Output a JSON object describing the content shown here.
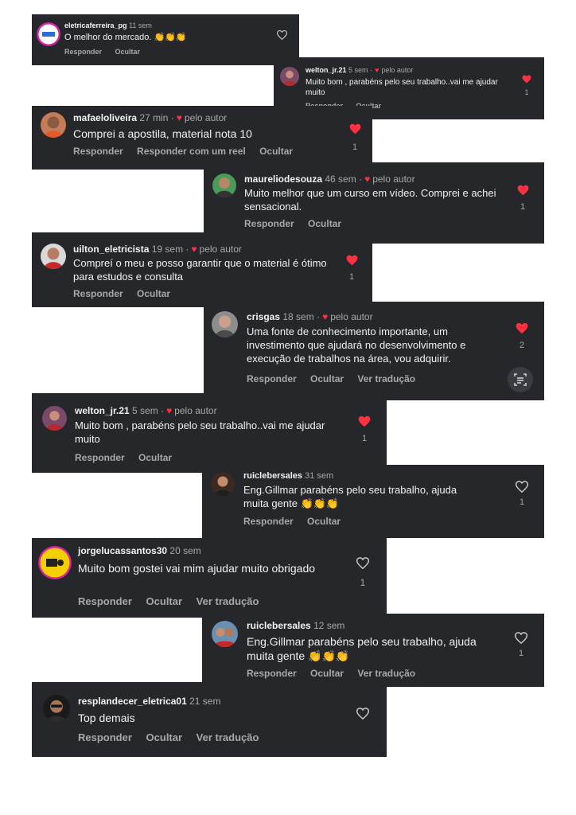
{
  "labels": {
    "reply": "Responder",
    "reply_reel": "Responder com um reel",
    "hide": "Ocultar",
    "translate": "Ver tradução",
    "by_author": "pelo autor"
  },
  "comments": [
    {
      "user": "eletricaferreira_pg",
      "time": "11 sem",
      "text": "O melhor do mercado. 👏👏👏",
      "liked_by_author": false,
      "heart": "outline",
      "likes": ""
    },
    {
      "user": "welton_jr.21",
      "time": "5 sem",
      "text": "Muito bom , parabéns pelo seu trabalho..vai me ajudar muito",
      "liked_by_author": true,
      "heart": "filled",
      "likes": "1"
    },
    {
      "user": "mafaeloliveira",
      "time": "27 min",
      "text": "Comprei a apostila, material nota 10",
      "liked_by_author": true,
      "heart": "filled",
      "likes": "1"
    },
    {
      "user": "maureliodesouza",
      "time": "46 sem",
      "text": "Muito melhor que um curso em vídeo. Comprei e achei sensacional.",
      "liked_by_author": true,
      "heart": "filled",
      "likes": "1"
    },
    {
      "user": "uilton_eletricista",
      "time": "19 sem",
      "text": "Compreí o meu e posso garantir que o material é ótimo para estudos e consulta",
      "liked_by_author": true,
      "heart": "filled",
      "likes": "1"
    },
    {
      "user": "crisgas",
      "time": "18 sem",
      "text": "Uma fonte de conhecimento importante, um investimento que ajudará no desenvolvimento e execução de trabalhos na área, vou adquirir.",
      "liked_by_author": true,
      "heart": "filled",
      "likes": "2"
    },
    {
      "user": "welton_jr.21",
      "time": "5 sem",
      "text": "Muito bom , parabéns pelo seu trabalho..vai me ajudar muito",
      "liked_by_author": true,
      "heart": "filled",
      "likes": "1"
    },
    {
      "user": "ruiclebersales",
      "time": "31 sem",
      "text": "Eng.Gillmar parabéns pelo seu trabalho, ajuda muita gente 👏👏👏",
      "liked_by_author": false,
      "heart": "outline",
      "likes": "1"
    },
    {
      "user": "jorgelucassantos30",
      "time": "20 sem",
      "text": "Muito bom gostei vai mim ajudar muito obrigado",
      "liked_by_author": false,
      "heart": "outline",
      "likes": "1"
    },
    {
      "user": "ruiclebersales",
      "time": "12 sem",
      "text": "Eng.Gillmar parabéns pelo seu trabalho, ajuda muita gente 👏👏👏",
      "liked_by_author": false,
      "heart": "outline",
      "likes": "1"
    },
    {
      "user": "resplandecer_eletrica01",
      "time": "21 sem",
      "text": "Top demais",
      "liked_by_author": false,
      "heart": "outline",
      "likes": ""
    }
  ],
  "colors": {
    "card_bg": "#25272b",
    "heart_red": "#ff3040",
    "muted_text": "#a8a8a8"
  }
}
